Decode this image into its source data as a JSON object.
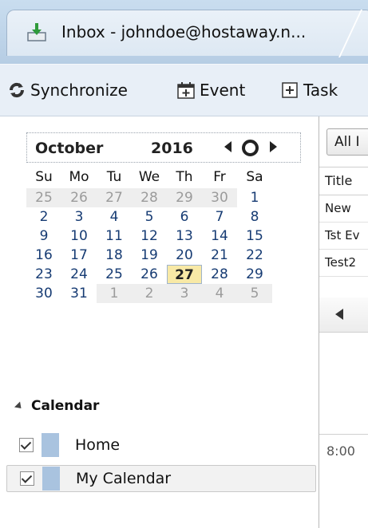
{
  "tab": {
    "title": "Inbox - johndoe@hostaway.n..."
  },
  "toolbar": {
    "synchronize_label": "Synchronize",
    "event_label": "Event",
    "task_label": "Task"
  },
  "minimonth": {
    "month": "October",
    "year": "2016",
    "weekdays": [
      "Su",
      "Mo",
      "Tu",
      "We",
      "Th",
      "Fr",
      "Sa"
    ],
    "weeks": [
      [
        "25",
        "26",
        "27",
        "28",
        "29",
        "30",
        "1"
      ],
      [
        "2",
        "3",
        "4",
        "5",
        "6",
        "7",
        "8"
      ],
      [
        "9",
        "10",
        "11",
        "12",
        "13",
        "14",
        "15"
      ],
      [
        "16",
        "17",
        "18",
        "19",
        "20",
        "21",
        "22"
      ],
      [
        "23",
        "24",
        "25",
        "26",
        "27",
        "28",
        "29"
      ],
      [
        "30",
        "31",
        "1",
        "2",
        "3",
        "4",
        "5"
      ]
    ],
    "selected_day": "27"
  },
  "calendar_list": {
    "title": "Calendar",
    "items": [
      {
        "name": "Home",
        "color": "#a9c3df",
        "checked": true
      },
      {
        "name": "My Calendar",
        "color": "#a9c3df",
        "checked": true
      }
    ]
  },
  "right_pane": {
    "filter_label": "All I",
    "column_title": "Title",
    "rows": [
      "New",
      "Tst Ev",
      "Test2"
    ],
    "time_label": "8:00"
  }
}
